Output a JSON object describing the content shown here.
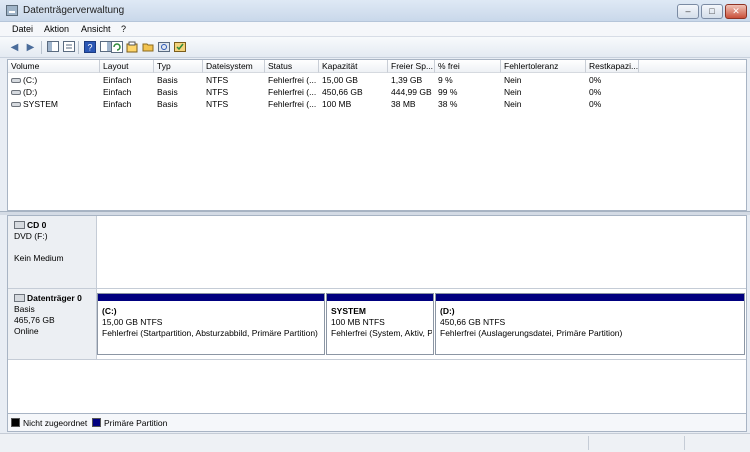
{
  "window": {
    "title": "Datenträgerverwaltung",
    "minimize_glyph": "–",
    "maximize_glyph": "□",
    "close_glyph": "✕"
  },
  "menu": {
    "items": [
      "Datei",
      "Aktion",
      "Ansicht",
      "?"
    ]
  },
  "toolbar": {
    "icons": [
      "back-icon",
      "forward-icon",
      "console-tree-icon",
      "properties-icon",
      "help-icon",
      "action-pane-icon",
      "refresh-icon",
      "rescan-icon",
      "open-icon",
      "search-icon",
      "settings-icon"
    ]
  },
  "volumes": {
    "columns": [
      "Volume",
      "Layout",
      "Typ",
      "Dateisystem",
      "Status",
      "Kapazität",
      "Freier Sp...",
      "% frei",
      "Fehlertoleranz",
      "Restkapazi..."
    ],
    "rows": [
      [
        "(C:)",
        "Einfach",
        "Basis",
        "NTFS",
        "Fehlerfrei (...",
        "15,00 GB",
        "1,39 GB",
        "9 %",
        "Nein",
        "0%"
      ],
      [
        "(D:)",
        "Einfach",
        "Basis",
        "NTFS",
        "Fehlerfrei (...",
        "450,66 GB",
        "444,99 GB",
        "99 %",
        "Nein",
        "0%"
      ],
      [
        "SYSTEM",
        "Einfach",
        "Basis",
        "NTFS",
        "Fehlerfrei (...",
        "100 MB",
        "38 MB",
        "38 %",
        "Nein",
        "0%"
      ]
    ]
  },
  "disks": {
    "cd": {
      "name": "CD 0",
      "line1": "DVD (F:)",
      "line2": "Kein Medium"
    },
    "disk0": {
      "name": "Datenträger 0",
      "type": "Basis",
      "size": "465,76 GB",
      "state": "Online",
      "partitions": [
        {
          "name": "(C:)",
          "size": "15,00 GB NTFS",
          "status": "Fehlerfrei (Startpartition, Absturzabbild, Primäre Partition)"
        },
        {
          "name": "SYSTEM",
          "size": "100 MB NTFS",
          "status": "Fehlerfrei (System, Aktiv, P"
        },
        {
          "name": "(D:)",
          "size": "450,66 GB NTFS",
          "status": "Fehlerfrei (Auslagerungsdatei, Primäre Partition)"
        }
      ]
    }
  },
  "legend": {
    "unallocated": "Nicht zugeordnet",
    "primary": "Primäre Partition",
    "unallocated_color": "#000000",
    "primary_color": "#00007f"
  }
}
